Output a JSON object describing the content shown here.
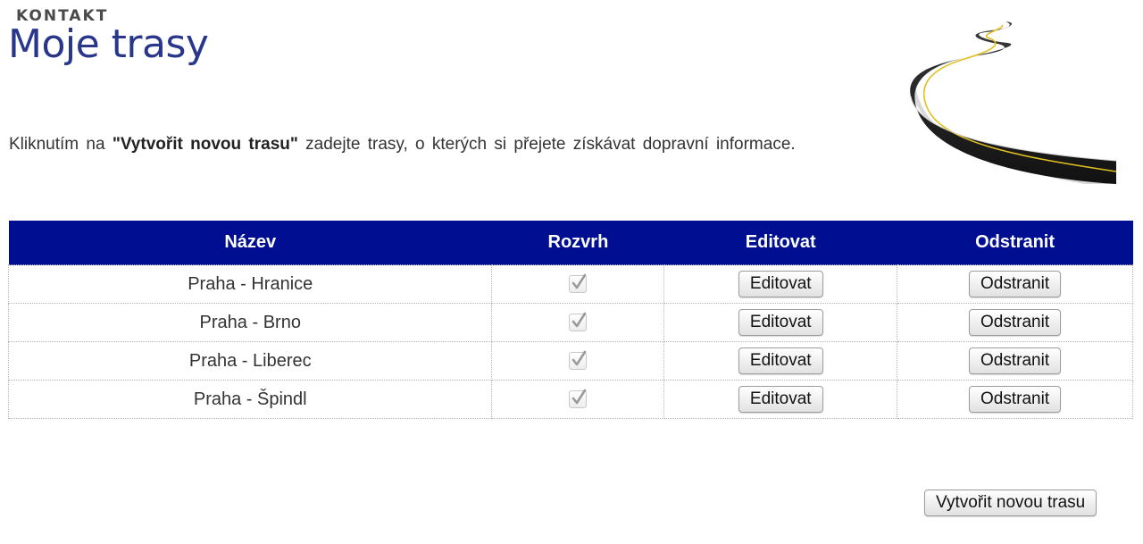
{
  "header": {
    "kicker": "KONTAKT",
    "title": "Moje trasy"
  },
  "intro": {
    "before": "Kliknutím na ",
    "highlight": "\"Vytvořit novou trasu\"",
    "after": " zadejte trasy, o kterých si přejete získávat dopravní informace."
  },
  "table": {
    "headers": {
      "name": "Název",
      "schedule": "Rozvrh",
      "edit": "Editovat",
      "delete": "Odstranit"
    },
    "rows": [
      {
        "name": "Praha - Hranice",
        "schedule_checked": true,
        "edit_label": "Editovat",
        "delete_label": "Odstranit"
      },
      {
        "name": "Praha - Brno",
        "schedule_checked": true,
        "edit_label": "Editovat",
        "delete_label": "Odstranit"
      },
      {
        "name": "Praha - Liberec",
        "schedule_checked": true,
        "edit_label": "Editovat",
        "delete_label": "Odstranit"
      },
      {
        "name": "Praha - Špindl",
        "schedule_checked": true,
        "edit_label": "Editovat",
        "delete_label": "Odstranit"
      }
    ]
  },
  "actions": {
    "create_label": "Vytvořit novou trasu"
  },
  "colors": {
    "header_bg": "#000e91",
    "title": "#28368c"
  },
  "icons": {
    "illustration": "road-illustration",
    "checkbox": "checkmark-icon"
  }
}
